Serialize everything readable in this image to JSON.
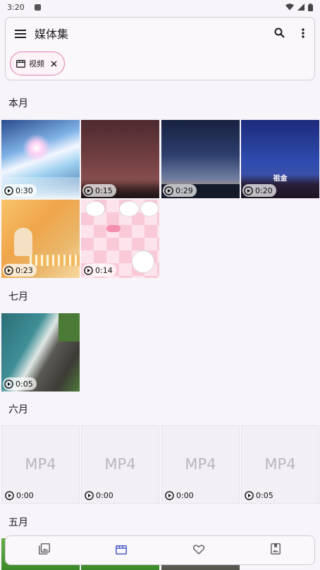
{
  "status_bar": {
    "time": "3:20"
  },
  "app_bar": {
    "title": "媒体集",
    "filter_chip_label": "视频"
  },
  "sections": [
    {
      "title": "本月",
      "items": [
        {
          "duration": "0:30"
        },
        {
          "duration": "0:15"
        },
        {
          "duration": "0:29"
        },
        {
          "duration": "0:20",
          "overlay_text": "祖金"
        },
        {
          "duration": "0:23"
        },
        {
          "duration": "0:14"
        }
      ]
    },
    {
      "title": "七月",
      "items": [
        {
          "duration": "0:05"
        }
      ]
    },
    {
      "title": "六月",
      "items": [
        {
          "placeholder": "MP4",
          "duration": "0:00"
        },
        {
          "placeholder": "MP4",
          "duration": "0:00"
        },
        {
          "placeholder": "MP4",
          "duration": "0:00"
        },
        {
          "placeholder": "MP4",
          "duration": "0:05"
        }
      ]
    },
    {
      "title": "五月",
      "items": []
    }
  ],
  "bottom_nav": {
    "items": [
      {
        "icon": "photos-icon",
        "active": false
      },
      {
        "icon": "video-clapper-icon",
        "active": true
      },
      {
        "icon": "heart-icon",
        "active": false
      },
      {
        "icon": "album-icon",
        "active": false
      }
    ],
    "active_color": "#4a5ac9",
    "inactive_color": "#5c5a60"
  },
  "colors": {
    "chip_border": "#e57ab0",
    "background": "#f8f5fa"
  }
}
